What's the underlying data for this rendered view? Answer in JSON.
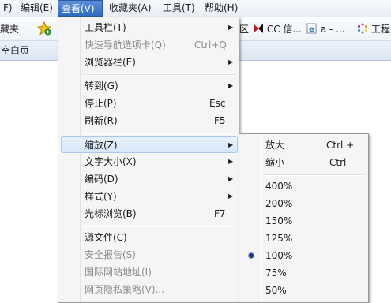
{
  "menubar": {
    "items": [
      {
        "label": "F)"
      },
      {
        "label": "编辑(E)"
      },
      {
        "label": "查看(V)"
      },
      {
        "label": "收藏夹(A)"
      },
      {
        "label": "工具(T)"
      },
      {
        "label": "帮助(H)"
      }
    ]
  },
  "favbar": {
    "favorites_label": "藏夹",
    "star_icon": "star-icon",
    "fav_items": [
      {
        "label": "区"
      },
      {
        "label": "CC 信..."
      },
      {
        "label": "a - ..."
      },
      {
        "label": "工程"
      }
    ]
  },
  "tabstrip": {
    "tab_label": "空白页"
  },
  "view_menu": {
    "items": [
      {
        "label": "工具栏(T)",
        "submenu": true
      },
      {
        "label": "快速导航选项卡(Q)",
        "shortcut": "Ctrl+Q",
        "disabled": true
      },
      {
        "label": "浏览器栏(E)",
        "submenu": true
      },
      {
        "label": "转到(G)",
        "submenu": true
      },
      {
        "label": "停止(P)",
        "shortcut": "Esc"
      },
      {
        "label": "刷新(R)",
        "shortcut": "F5"
      },
      {
        "label": "缩放(Z)",
        "submenu": true,
        "highlighted": true
      },
      {
        "label": "文字大小(X)",
        "submenu": true
      },
      {
        "label": "编码(D)",
        "submenu": true
      },
      {
        "label": "样式(Y)",
        "submenu": true
      },
      {
        "label": "光标浏览(B)",
        "shortcut": "F7"
      },
      {
        "label": "源文件(C)"
      },
      {
        "label": "安全报告(S)",
        "disabled": true
      },
      {
        "label": "国际网站地址(I)",
        "disabled": true
      },
      {
        "label": "网页隐私策略(V)...",
        "disabled": true
      }
    ]
  },
  "zoom_menu": {
    "zoom_in": {
      "label": "放大",
      "shortcut": "Ctrl +"
    },
    "zoom_out": {
      "label": "缩小",
      "shortcut": "Ctrl -"
    },
    "levels": [
      "400%",
      "200%",
      "150%",
      "125%",
      "100%",
      "75%",
      "50%"
    ],
    "selected_level": "100%"
  }
}
